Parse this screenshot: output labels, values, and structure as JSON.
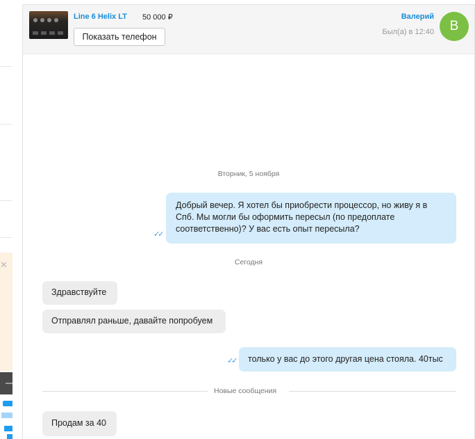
{
  "listing": {
    "title": "Line 6 Helix LT",
    "price": "50 000 ₽",
    "phone_button": "Показать телефон"
  },
  "user": {
    "name": "Валерий",
    "last_seen": "Был(а) в 12:40",
    "avatar_letter": "В",
    "avatar_color": "#7bc044"
  },
  "colors": {
    "accent": "#1a8cd8",
    "outgoing_bubble": "#d4ecfb",
    "incoming_bubble": "#ededed"
  },
  "chat": {
    "date_1": "Вторник, 5 ноября",
    "date_2": "Сегодня",
    "new_messages_label": "Новые сообщения",
    "messages": [
      {
        "direction": "out",
        "read": true,
        "text": "Добрый вечер. Я хотел бы приобрести процессор, но живу я в Спб. Мы могли бы оформить пересыл (по предоплате соответственно)? У вас есть опыт пересыла?"
      },
      {
        "direction": "in",
        "text": "Здравствуйте"
      },
      {
        "direction": "in",
        "text": "Отправлял раньше, давайте попробуем"
      },
      {
        "direction": "out",
        "read": true,
        "text": "только у вас до этого другая цена стояла. 40тыс"
      },
      {
        "direction": "in",
        "text": "Продам за 40"
      }
    ]
  }
}
